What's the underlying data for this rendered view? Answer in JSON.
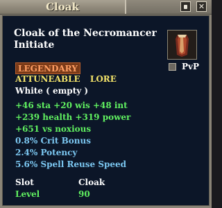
{
  "window": {
    "title": "Cloak",
    "lock_button": "lock",
    "close_button": "✕"
  },
  "item": {
    "name": "Cloak of the Necromancer Initiate",
    "icon": "cloak-icon",
    "pvp_label": "PvP",
    "pvp_checked": false,
    "tier": "LEGENDARY",
    "flags": [
      "ATTUNEABLE",
      "LORE"
    ],
    "adornment": "White ( empty )",
    "stats_green": [
      "+46 sta  +20 wis  +48 int",
      "+239 health  +319 power",
      "+651 vs noxious"
    ],
    "stats_blue": [
      "0.8% Crit Bonus",
      "2.4% Potency",
      "5.6% Spell Reuse Speed"
    ],
    "slot_label": "Slot",
    "slot_value": "Cloak",
    "level_label": "Level",
    "level_value": "90"
  },
  "colors": {
    "green": "#60f060",
    "blue": "#7cc8f2",
    "legendary_text": "#ff9e63",
    "legendary_bg": "#7a3a18",
    "flags": "#f4e46a"
  }
}
